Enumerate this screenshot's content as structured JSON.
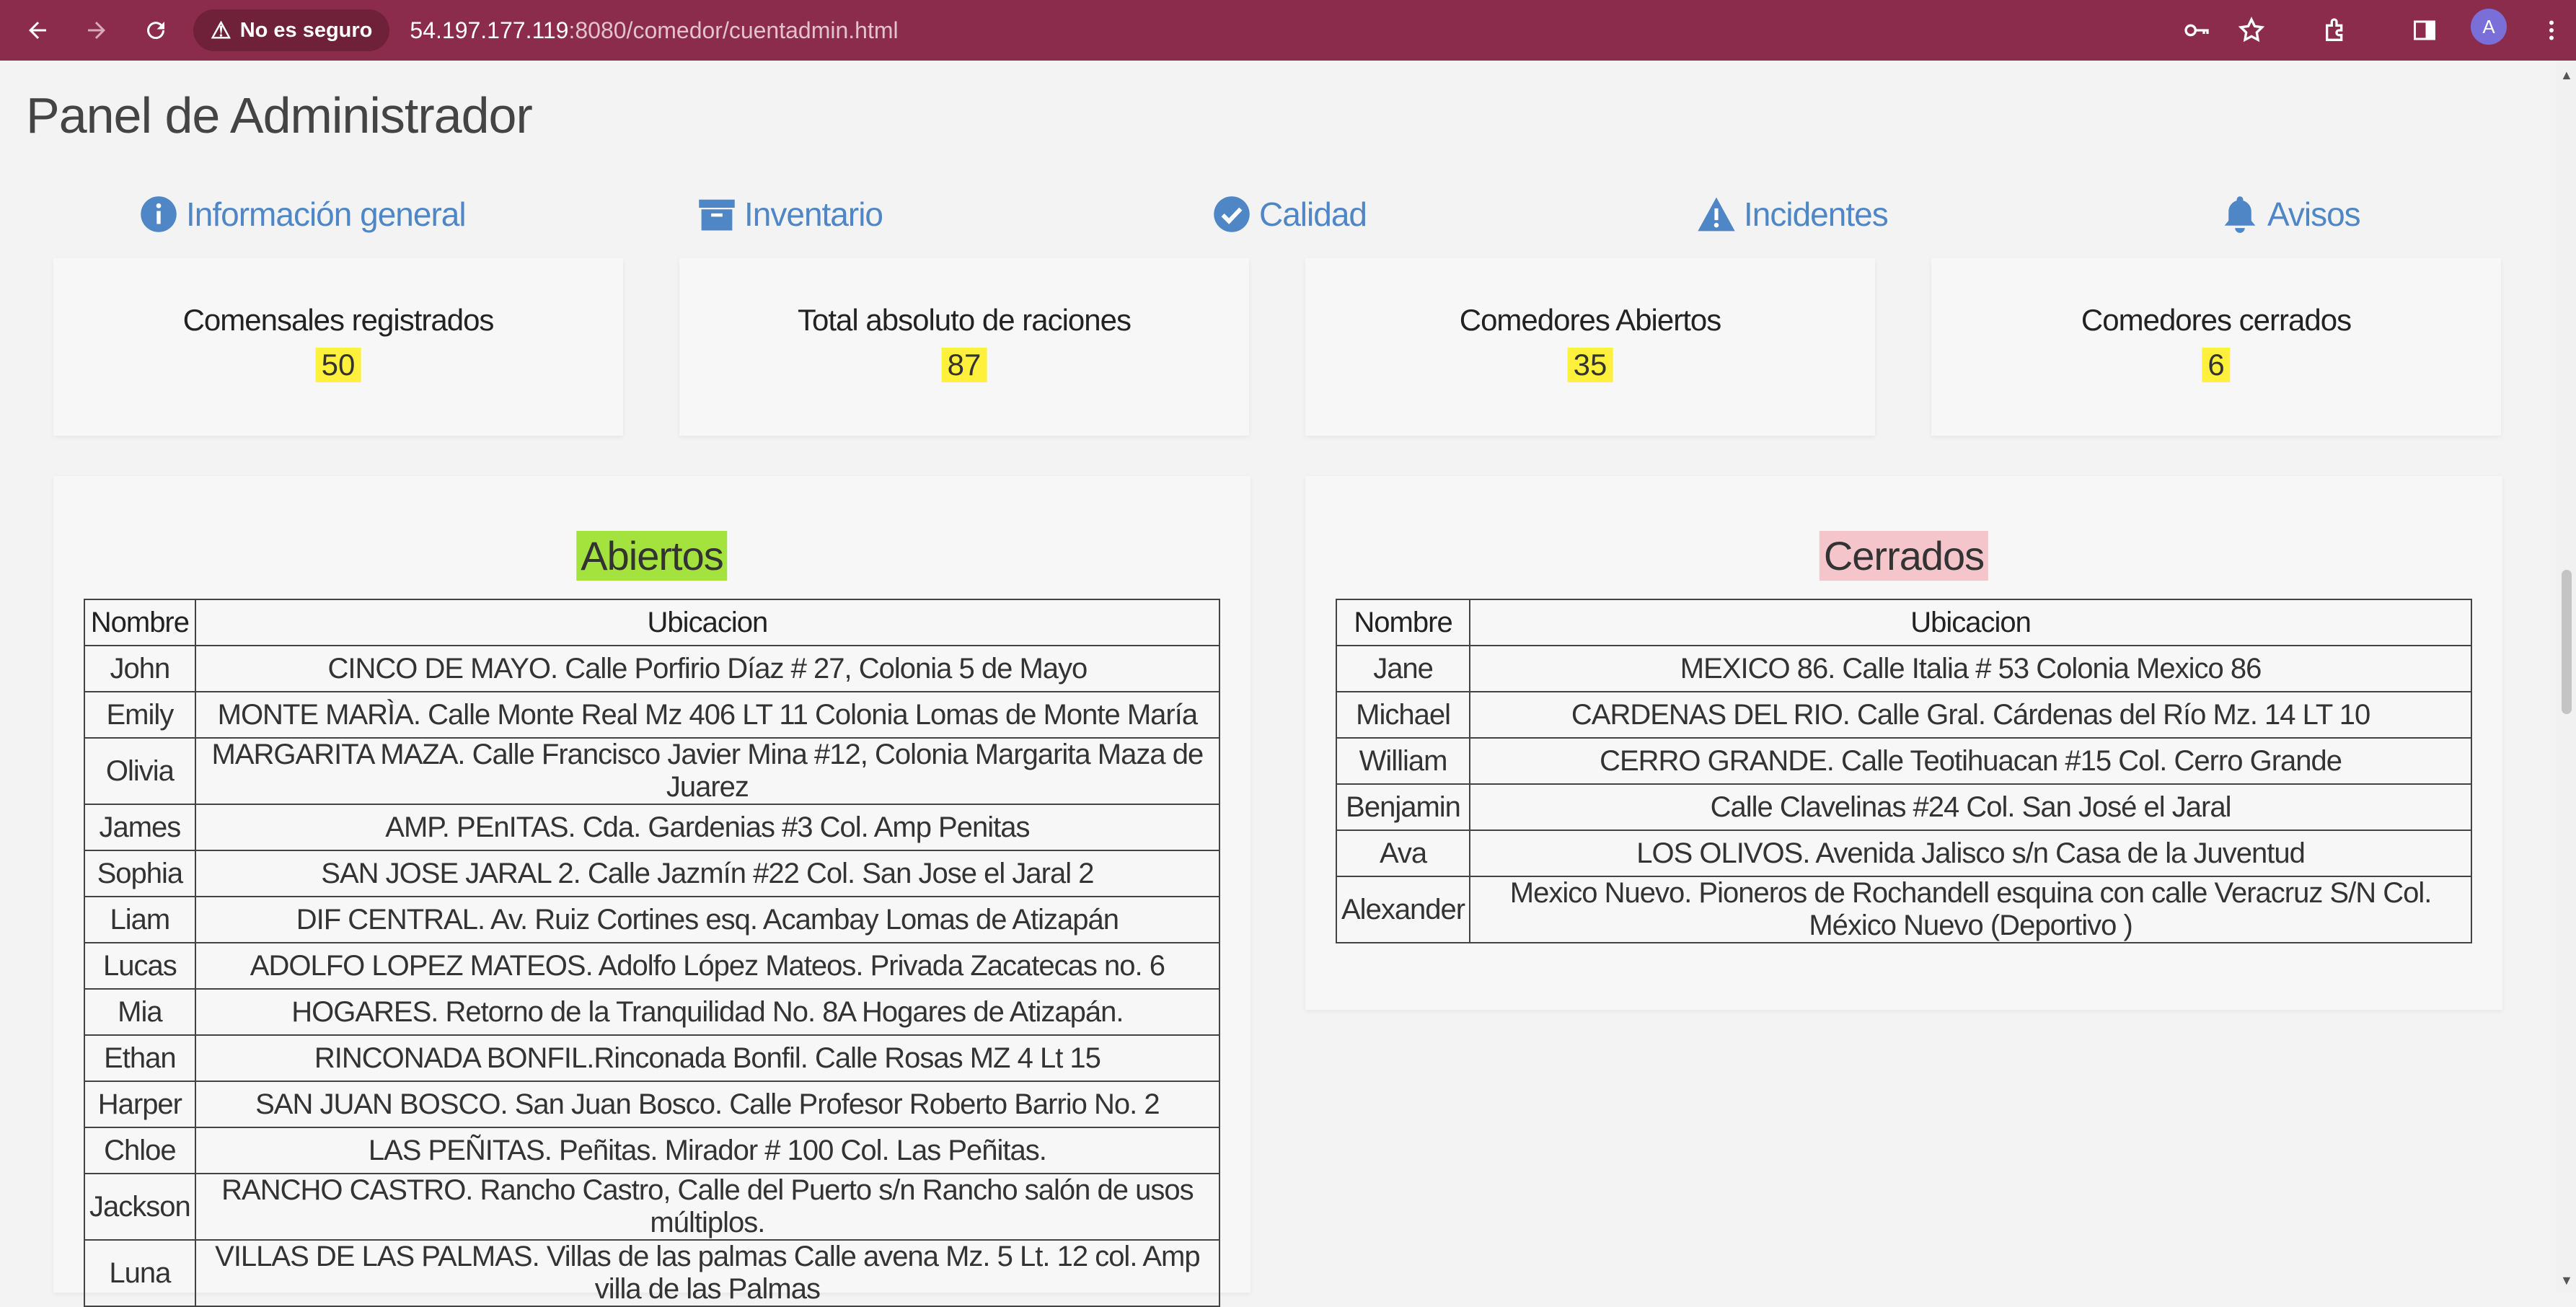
{
  "browser": {
    "security_label": "No es seguro",
    "url_host": "54.197.177.119",
    "url_path": ":8080/comedor/cuentadmin.html",
    "avatar_letter": "A"
  },
  "page": {
    "title": "Panel de Administrador",
    "tabs": [
      {
        "label": "Información general",
        "icon": "info-icon"
      },
      {
        "label": "Inventario",
        "icon": "archive-box-icon"
      },
      {
        "label": "Calidad",
        "icon": "check-circle-icon"
      },
      {
        "label": "Incidentes",
        "icon": "warning-triangle-icon"
      },
      {
        "label": "Avisos",
        "icon": "bell-icon"
      }
    ],
    "stats": [
      {
        "label": "Comensales registrados",
        "value": "50"
      },
      {
        "label": "Total absoluto de raciones",
        "value": "87"
      },
      {
        "label": "Comedores Abiertos",
        "value": "35"
      },
      {
        "label": "Comedores cerrados",
        "value": "6"
      }
    ]
  },
  "open_panel": {
    "title": "Abiertos",
    "headers": {
      "name": "Nombre",
      "location": "Ubicacion"
    },
    "rows": [
      {
        "name": "John",
        "location": "CINCO DE MAYO. Calle Porfirio Díaz # 27, Colonia 5 de Mayo"
      },
      {
        "name": "Emily",
        "location": "MONTE MARÌA. Calle Monte Real Mz 406 LT 11 Colonia Lomas de Monte María"
      },
      {
        "name": "Olivia",
        "location": "MARGARITA MAZA. Calle Francisco Javier Mina #12, Colonia Margarita Maza de Juarez"
      },
      {
        "name": "James",
        "location": "AMP. PEnITAS. Cda. Gardenias #3 Col. Amp Penitas"
      },
      {
        "name": "Sophia",
        "location": "SAN JOSE JARAL 2. Calle Jazmín #22 Col. San Jose el Jaral 2"
      },
      {
        "name": "Liam",
        "location": "DIF CENTRAL. Av. Ruiz Cortines esq. Acambay Lomas de Atizapán"
      },
      {
        "name": "Lucas",
        "location": "ADOLFO LOPEZ MATEOS. Adolfo López Mateos. Privada Zacatecas no. 6"
      },
      {
        "name": "Mia",
        "location": "HOGARES. Retorno de la Tranquilidad No. 8A Hogares de Atizapán."
      },
      {
        "name": "Ethan",
        "location": "RINCONADA BONFIL.Rinconada Bonfil. Calle Rosas MZ 4 Lt 15"
      },
      {
        "name": "Harper",
        "location": "SAN JUAN BOSCO. San Juan Bosco. Calle Profesor Roberto Barrio No. 2"
      },
      {
        "name": "Chloe",
        "location": "LAS PEÑITAS. Peñitas. Mirador # 100 Col. Las Peñitas."
      },
      {
        "name": "Jackson",
        "location": "RANCHO CASTRO. Rancho Castro, Calle del Puerto s/n Rancho salón de usos múltiplos."
      },
      {
        "name": "Luna",
        "location": "VILLAS DE LAS PALMAS. Villas de las palmas Calle avena Mz. 5 Lt. 12 col. Amp villa de las Palmas"
      }
    ]
  },
  "closed_panel": {
    "title": "Cerrados",
    "headers": {
      "name": "Nombre",
      "location": "Ubicacion"
    },
    "rows": [
      {
        "name": "Jane",
        "location": "MEXICO 86. Calle Italia # 53 Colonia Mexico 86"
      },
      {
        "name": "Michael",
        "location": "CARDENAS DEL RIO. Calle Gral. Cárdenas del Río Mz. 14 LT 10"
      },
      {
        "name": "William",
        "location": "CERRO GRANDE. Calle Teotihuacan #15 Col. Cerro Grande"
      },
      {
        "name": "Benjamin",
        "location": "Calle Clavelinas #24 Col. San José el Jaral"
      },
      {
        "name": "Ava",
        "location": "LOS OLIVOS. Avenida Jalisco s/n Casa de la Juventud"
      },
      {
        "name": "Alexander",
        "location": "Mexico Nuevo. Pioneros de Rochandell esquina con calle Veracruz S/N Col. México Nuevo (Deportivo )"
      }
    ]
  },
  "colors": {
    "chrome": "#8b2c4c",
    "link": "#4f86c6",
    "highlight_yellow": "#fff03c",
    "open_green": "#a4e33e",
    "closed_pink": "#f4c6cc"
  }
}
